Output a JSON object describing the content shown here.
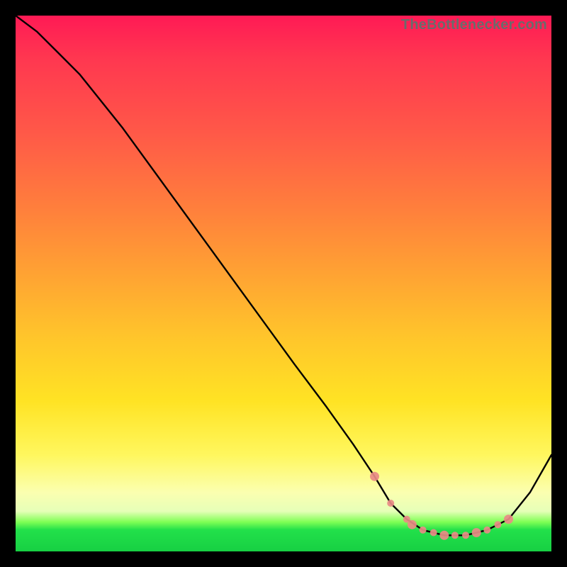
{
  "watermark": "TheBottlenecker.com",
  "chart_data": {
    "type": "line",
    "title": "",
    "xlabel": "",
    "ylabel": "",
    "xlim": [
      0,
      100
    ],
    "ylim": [
      0,
      100
    ],
    "series": [
      {
        "name": "curve",
        "x": [
          0,
          4,
          8,
          12,
          20,
          28,
          36,
          44,
          52,
          58,
          63,
          67,
          70,
          73,
          76,
          80,
          84,
          88,
          92,
          96,
          100
        ],
        "y": [
          100,
          97,
          93,
          89,
          79,
          68,
          57,
          46,
          35,
          27,
          20,
          14,
          9,
          6,
          4,
          3,
          3,
          4,
          6,
          11,
          18
        ]
      }
    ],
    "markers": {
      "name": "highlight-points",
      "x": [
        67,
        70,
        73,
        74,
        76,
        78,
        80,
        82,
        84,
        86,
        88,
        90,
        92
      ],
      "y": [
        14,
        9,
        6,
        5,
        4,
        3.5,
        3,
        3,
        3,
        3.5,
        4,
        5,
        6
      ]
    },
    "gradient_stops": [
      {
        "pos": 0.0,
        "color": "#ff1a55"
      },
      {
        "pos": 0.36,
        "color": "#ff7f3c"
      },
      {
        "pos": 0.72,
        "color": "#ffe324"
      },
      {
        "pos": 0.92,
        "color": "#e6ffb8"
      },
      {
        "pos": 0.96,
        "color": "#22e04a"
      },
      {
        "pos": 1.0,
        "color": "#17d043"
      }
    ]
  }
}
